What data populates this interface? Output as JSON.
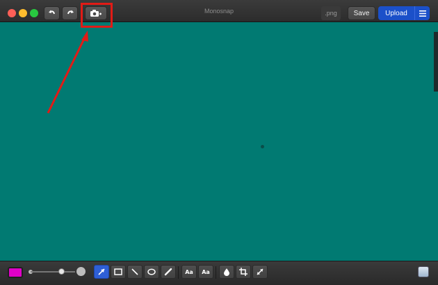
{
  "app": {
    "title": "Monosnap",
    "format": ".png"
  },
  "titlebar": {
    "save_label": "Save",
    "upload_label": "Upload",
    "icons": {
      "undo": "undo-icon",
      "redo": "redo-icon",
      "camera": "camera-icon",
      "menu": "hamburger-menu-icon"
    }
  },
  "toolbar": {
    "color": "#e000c8",
    "text_tool_label": "Aa",
    "text_style_tool_label": "Aa",
    "tools": [
      "arrow",
      "rectangle",
      "line",
      "ellipse",
      "pen",
      "text",
      "text-style",
      "blur",
      "crop",
      "resize"
    ]
  },
  "colors": {
    "canvas": "#017a72",
    "accent": "#1b50c9",
    "annotation": "#e21b16"
  }
}
